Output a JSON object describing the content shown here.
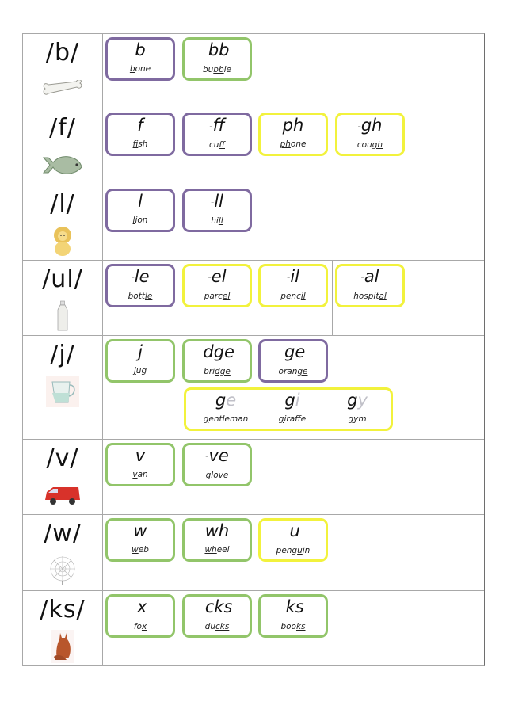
{
  "rows": [
    {
      "sound": "/b/",
      "picture": "bone",
      "cards": [
        {
          "dash": false,
          "grapheme": "b",
          "word_pre": "",
          "word_u": "b",
          "word_post": "one",
          "color": "purple"
        },
        {
          "dash": true,
          "grapheme": "bb",
          "word_pre": "bu",
          "word_u": "bb",
          "word_post": "le",
          "color": "green"
        }
      ]
    },
    {
      "sound": "/f/",
      "picture": "fish",
      "cards": [
        {
          "dash": false,
          "grapheme": "f",
          "word_pre": "",
          "word_u": "f",
          "word_post": "ish",
          "color": "purple"
        },
        {
          "dash": true,
          "grapheme": "ff",
          "word_pre": "cu",
          "word_u": "ff",
          "word_post": "",
          "color": "purple"
        },
        {
          "dash": false,
          "grapheme": "ph",
          "word_pre": "",
          "word_u": "ph",
          "word_post": "one",
          "color": "yellow"
        },
        {
          "dash": true,
          "grapheme": "gh",
          "word_pre": "cou",
          "word_u": "gh",
          "word_post": "",
          "color": "yellow"
        }
      ]
    },
    {
      "sound": "/l/",
      "picture": "lion",
      "cards": [
        {
          "dash": false,
          "grapheme": "l",
          "word_pre": "",
          "word_u": "l",
          "word_post": "ion",
          "color": "purple"
        },
        {
          "dash": true,
          "grapheme": "ll",
          "word_pre": "hi",
          "word_u": "ll",
          "word_post": "",
          "color": "purple"
        }
      ]
    },
    {
      "sound": "/ul/",
      "picture": "bottle",
      "cards": [
        {
          "dash": true,
          "grapheme": "le",
          "word_pre": "bott",
          "word_u": "le",
          "word_post": "",
          "color": "purple"
        },
        {
          "dash": true,
          "grapheme": "el",
          "word_pre": "parc",
          "word_u": "el",
          "word_post": "",
          "color": "yellow"
        },
        {
          "dash": true,
          "grapheme": "il",
          "word_pre": "penc",
          "word_u": "il",
          "word_post": "",
          "color": "yellow"
        },
        {
          "dash": true,
          "grapheme": "al",
          "word_pre": "hospit",
          "word_u": "al",
          "word_post": "",
          "color": "yellow"
        }
      ]
    },
    {
      "sound": "/j/",
      "picture": "jug",
      "cards": [
        {
          "dash": false,
          "grapheme": "j",
          "word_pre": "",
          "word_u": "j",
          "word_post": "ug",
          "color": "green"
        },
        {
          "dash": true,
          "grapheme": "dge",
          "word_pre": "bri",
          "word_u": "dge",
          "word_post": "",
          "color": "green"
        },
        {
          "dash": true,
          "grapheme": "ge",
          "word_pre": "oran",
          "word_u": "ge",
          "word_post": "",
          "color": "purple"
        }
      ],
      "soft_g": {
        "color": "yellow",
        "items": [
          {
            "g": "g",
            "vowel": "e",
            "word_u": "g",
            "word_post": "entleman"
          },
          {
            "g": "g",
            "vowel": "i",
            "word_u": "g",
            "word_post": "iraffe"
          },
          {
            "g": "g",
            "vowel": "y",
            "word_u": "g",
            "word_post": "ym"
          }
        ]
      }
    },
    {
      "sound": "/v/",
      "picture": "van",
      "cards": [
        {
          "dash": false,
          "grapheme": "v",
          "word_pre": "",
          "word_u": "v",
          "word_post": "an",
          "color": "green"
        },
        {
          "dash": true,
          "grapheme": "ve",
          "word_pre": "glo",
          "word_u": "ve",
          "word_post": "",
          "color": "green"
        }
      ]
    },
    {
      "sound": "/w/",
      "picture": "web",
      "cards": [
        {
          "dash": false,
          "grapheme": "w",
          "word_pre": "",
          "word_u": "w",
          "word_post": "eb",
          "color": "green"
        },
        {
          "dash": false,
          "grapheme": "wh",
          "word_pre": "",
          "word_u": "wh",
          "word_post": "eel",
          "color": "green"
        },
        {
          "dash": true,
          "grapheme": "u",
          "word_pre": "peng",
          "word_u": "u",
          "word_post": "in",
          "color": "yellow"
        }
      ]
    },
    {
      "sound": "/ks/",
      "picture": "fox",
      "cards": [
        {
          "dash": true,
          "grapheme": "x",
          "word_pre": "fo",
          "word_u": "x",
          "word_post": "",
          "color": "green"
        },
        {
          "dash": true,
          "grapheme": "cks",
          "word_pre": "du",
          "word_u": "cks",
          "word_post": "",
          "color": "green"
        },
        {
          "dash": true,
          "grapheme": "ks",
          "word_pre": "boo",
          "word_u": "ks",
          "word_post": "",
          "color": "green"
        }
      ]
    }
  ],
  "dash_glyph": "-"
}
